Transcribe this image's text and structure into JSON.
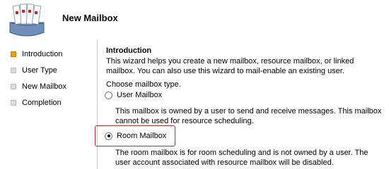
{
  "header": {
    "title": "New Mailbox",
    "icon": "mailbox-icon"
  },
  "sidebar": {
    "steps": [
      {
        "label": "Introduction",
        "active": true
      },
      {
        "label": "User Type",
        "active": false
      },
      {
        "label": "New Mailbox",
        "active": false
      },
      {
        "label": "Completion",
        "active": false
      }
    ]
  },
  "main": {
    "section_title": "Introduction",
    "intro_text": "This wizard helps you create a new mailbox, resource mailbox, or linked mailbox. You can also use this wizard to mail-enable an existing user.",
    "choose_label": "Choose mailbox type.",
    "options": [
      {
        "label": "User Mailbox",
        "checked": false,
        "description": "This mailbox is owned by a user to send and receive messages. This mailbox cannot be used for resource scheduling."
      },
      {
        "label": "Room Mailbox",
        "checked": true,
        "description": "The room mailbox is for room scheduling and is not owned by a user. The user account associated with resource mailbox will be disabled."
      }
    ]
  },
  "colors": {
    "active_step": "#f0a000",
    "inactive_step": "#dcdcdc",
    "highlight": "#b03030"
  }
}
